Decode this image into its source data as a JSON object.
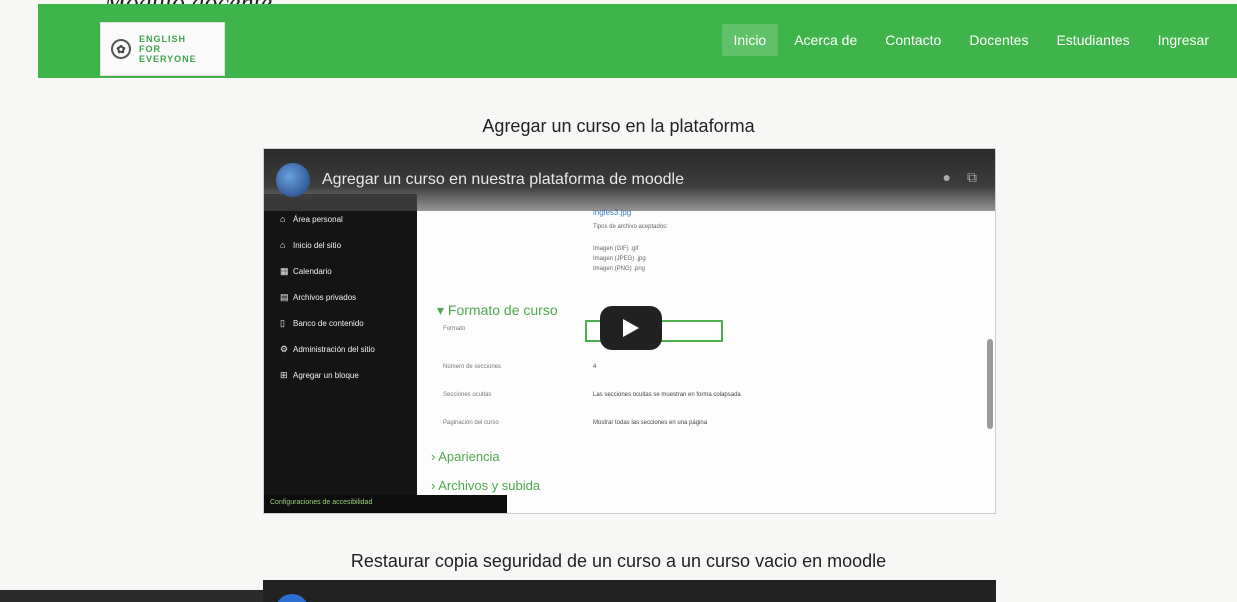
{
  "page": {
    "heading": "Modulo docente"
  },
  "navbar": {
    "logo": {
      "emblem": "✿",
      "text": "ENGLISH\nFOR\nEVERYONE"
    },
    "items": [
      {
        "label": "Inicio",
        "active": true
      },
      {
        "label": "Acerca de"
      },
      {
        "label": "Contacto"
      },
      {
        "label": "Docentes"
      },
      {
        "label": "Estudiantes"
      },
      {
        "label": "Ingresar"
      }
    ],
    "color": "#3fb44a"
  },
  "videos": [
    {
      "section_title": "Agregar un curso en la plataforma",
      "video_title": "Agregar un curso en nuestra plataforma de moodle",
      "sidebar": [
        {
          "icon": "home-icon",
          "label": "Área personal"
        },
        {
          "icon": "home-icon",
          "label": "Inicio del sitio"
        },
        {
          "icon": "calendar-icon",
          "label": "Calendario"
        },
        {
          "icon": "file-icon",
          "label": "Archivos privados"
        },
        {
          "icon": "database-icon",
          "label": "Banco de contenido"
        },
        {
          "icon": "gear-icon",
          "label": "Administración del sitio"
        },
        {
          "icon": "plus-icon",
          "label": "Agregar un bloque"
        }
      ],
      "sidebar_footer": "Configuraciones de accesibilidad",
      "content": {
        "image_caption": "ingles3.jpg",
        "accepted_types_label": "Tipos de archivo aceptados:",
        "accepted_types": [
          "Imagen (GIF) .gif",
          "Imagen (JPEG) .jpg",
          "Imagen (PNG) .png"
        ],
        "format_section": "Formato de curso",
        "fields": [
          {
            "label": "Formato",
            "value": ""
          },
          {
            "label": "Número de secciones",
            "value": "4"
          },
          {
            "label": "Secciones ocultas",
            "value": "Las secciones ocultas se muestran en forma colapsada"
          },
          {
            "label": "Paginación del curso",
            "value": "Mostrar todas las secciones en una página"
          }
        ],
        "sections": [
          "Apariencia",
          "Archivos y subida"
        ]
      }
    },
    {
      "section_title": "Restaurar copia seguridad de un curso a un curso vacio en moodle"
    }
  ]
}
